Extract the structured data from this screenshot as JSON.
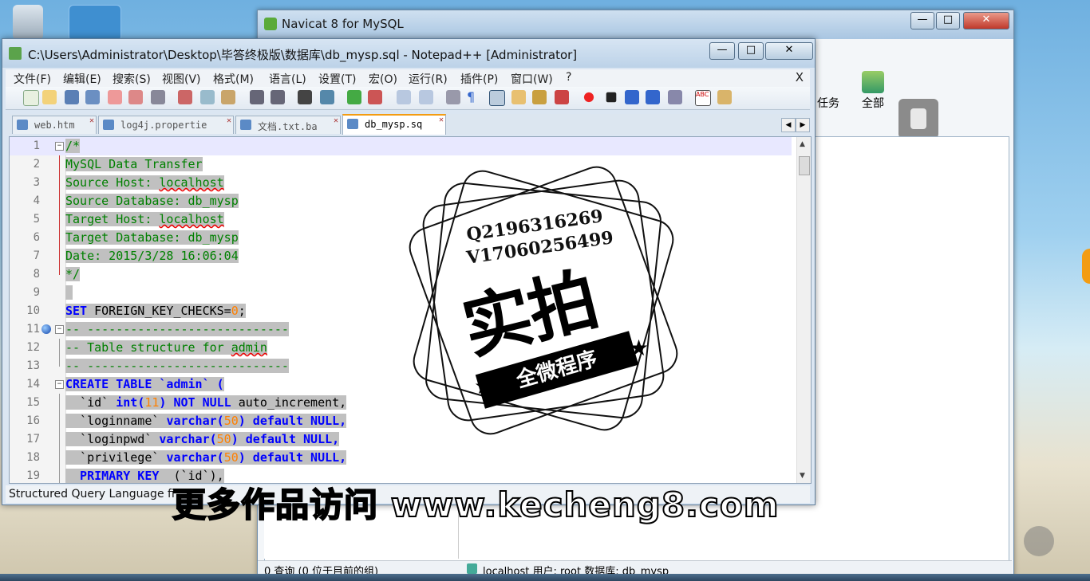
{
  "navicat": {
    "title": "Navicat 8 for MySQL",
    "toolbar": [
      {
        "label": "任务"
      },
      {
        "label": "全部"
      }
    ],
    "status_left": "0 查询 (0 位于目前的组)",
    "status_right": "localhost  用户: root  数据库: db_mysp"
  },
  "npp": {
    "title": "C:\\Users\\Administrator\\Desktop\\毕答终极版\\数据库\\db_mysp.sql - Notepad++ [Administrator]",
    "menu": [
      "文件(F)",
      "编辑(E)",
      "搜索(S)",
      "视图(V)",
      "格式(M)",
      "语言(L)",
      "设置(T)",
      "宏(O)",
      "运行(R)",
      "插件(P)",
      "窗口(W)",
      "?"
    ],
    "menu_close": "X",
    "tabs": [
      {
        "label": "web.htm"
      },
      {
        "label": "log4j.propertie"
      },
      {
        "label": "文档.txt.ba"
      },
      {
        "label": "db_mysp.sq"
      }
    ],
    "lines": [
      "1",
      "2",
      "3",
      "4",
      "5",
      "6",
      "7",
      "8",
      "9",
      "10",
      "11",
      "12",
      "13",
      "14",
      "15",
      "16",
      "17",
      "18",
      "19"
    ],
    "code": {
      "l1": "/*",
      "l2": "MySQL Data Transfer",
      "l3a": "Source Host: ",
      "l3b": "localhost",
      "l4": "Source Database: db_mysp",
      "l5a": "Target Host: ",
      "l5b": "localhost",
      "l6": "Target Database: db_mysp",
      "l7": "Date: 2015/3/28 16:06:04",
      "l8": "*/",
      "l10a": "SET",
      "l10b": " FOREIGN_KEY_CHECKS=",
      "l10c": "0",
      "l10d": ";",
      "l11": "-- ----------------------------",
      "l12a": "-- Table structure for ",
      "l12b": "admin",
      "l13": "-- ----------------------------",
      "l14a": "CREATE TABLE",
      "l14b": " `admin` (",
      "l15a": "  `id` ",
      "l15b": "int",
      "l15c": "(",
      "l15d": "11",
      "l15e": ") NOT NULL",
      "l15f": " auto_increment,",
      "l16a": "  `loginname` ",
      "l16b": "varchar",
      "l16c": "(",
      "l16d": "50",
      "l16e": ") default NULL,",
      "l17a": "  `loginpwd` ",
      "l17b": "varchar",
      "l17c": "(",
      "l17d": "50",
      "l17e": ") default NULL,",
      "l18a": "  `privilege` ",
      "l18b": "varchar",
      "l18c": "(",
      "l18d": "50",
      "l18e": ") default NULL,",
      "l19a": "  PRIMARY KEY",
      "l19b": "  (`id`),"
    },
    "status": "Structured Query Language fi"
  },
  "stamp": {
    "line1": "Q2196316269",
    "line2": "V17060256499",
    "big": "实拍",
    "ribbon": "全微程序"
  },
  "watermark": "更多作品访问 www.kecheng8.com",
  "colors": {
    "comment": "#008000",
    "keyword": "#0000ff",
    "number": "#ff8000",
    "selection": "#c0c0c0"
  }
}
